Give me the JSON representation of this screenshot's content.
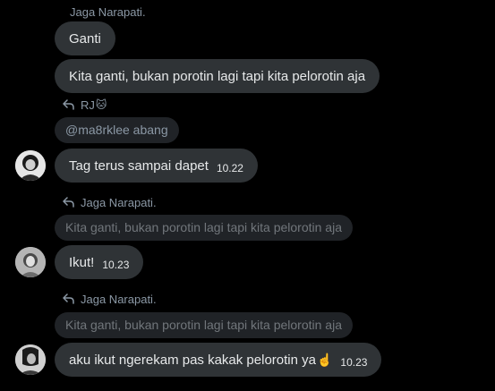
{
  "messages": {
    "top_reply_name": "Jaga Narapati.",
    "bubble_ganti": "Ganti",
    "bubble_kita_ganti": "Kita ganti, bukan porotin lagi tapi kita pelorotin aja",
    "reply_rj_name": "RJ",
    "reply_rj_emoji": "🐱",
    "mention_pill": "@ma8rklee abang",
    "bubble_tag": "Tag terus sampai dapet",
    "time_tag": "10.22",
    "reply2_name": "Jaga Narapati.",
    "quote2": "Kita ganti, bukan porotin lagi tapi kita pelorotin aja",
    "bubble_ikut": "Ikut!",
    "time_ikut": "10.23",
    "reply3_name": "Jaga Narapati.",
    "quote3": "Kita ganti, bukan porotin lagi tapi kita pelorotin aja",
    "bubble_aku": "aku ikut ngerekam pas kakak pelorotin ya",
    "bubble_aku_emoji": "☝️",
    "time_aku": "10.23"
  },
  "colors": {
    "background": "#000000",
    "bubble": "#2f3336",
    "quote": "#202327",
    "muted_text": "#71767b"
  },
  "icons": [
    "reply-arrow-icon"
  ]
}
